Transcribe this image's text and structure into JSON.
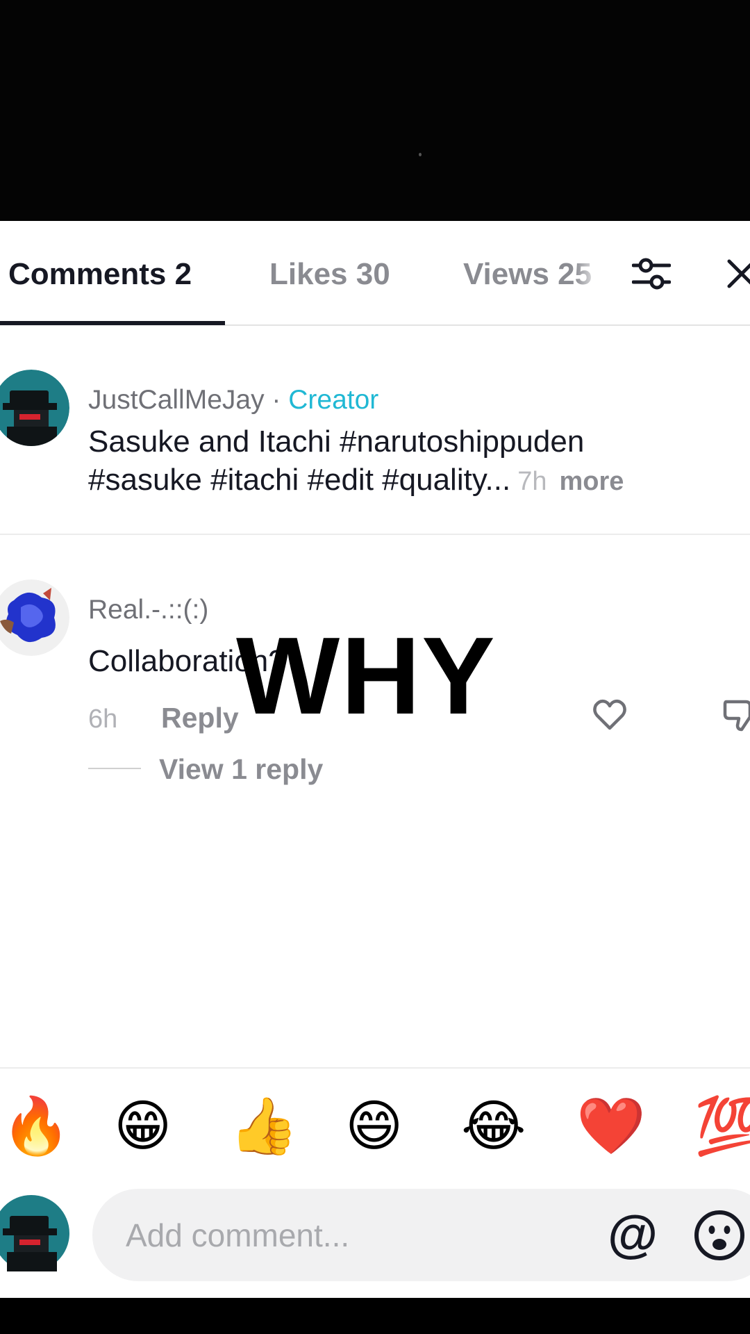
{
  "tabs": {
    "comments": "Comments 2",
    "likes": "Likes 30",
    "views": "Views 25"
  },
  "comments": [
    {
      "username": "JustCallMeJay",
      "separator": " · ",
      "badge": "Creator",
      "text_line1": "Sasuke and Itachi #narutoshippuden",
      "text_line2": "#sasuke #itachi #edit #quality...",
      "time": "7h",
      "more": "more"
    },
    {
      "username": "Real.-.::(:)",
      "text": "Collaboration?",
      "time": "6h",
      "reply": "Reply",
      "view_replies": "View 1 reply"
    }
  ],
  "overlay_text": "WHY",
  "emoji_bar": [
    "🔥",
    "😁",
    "👍",
    "😄",
    "😂",
    "❤️",
    "💯"
  ],
  "input": {
    "placeholder": "Add comment...",
    "mention_symbol": "@"
  },
  "icons": {
    "filter": "sliders-filter-icon",
    "close": "close-icon",
    "like": "heart-outline-icon",
    "dislike": "thumbs-down-icon",
    "emoji_picker": "smiley-face-icon"
  }
}
